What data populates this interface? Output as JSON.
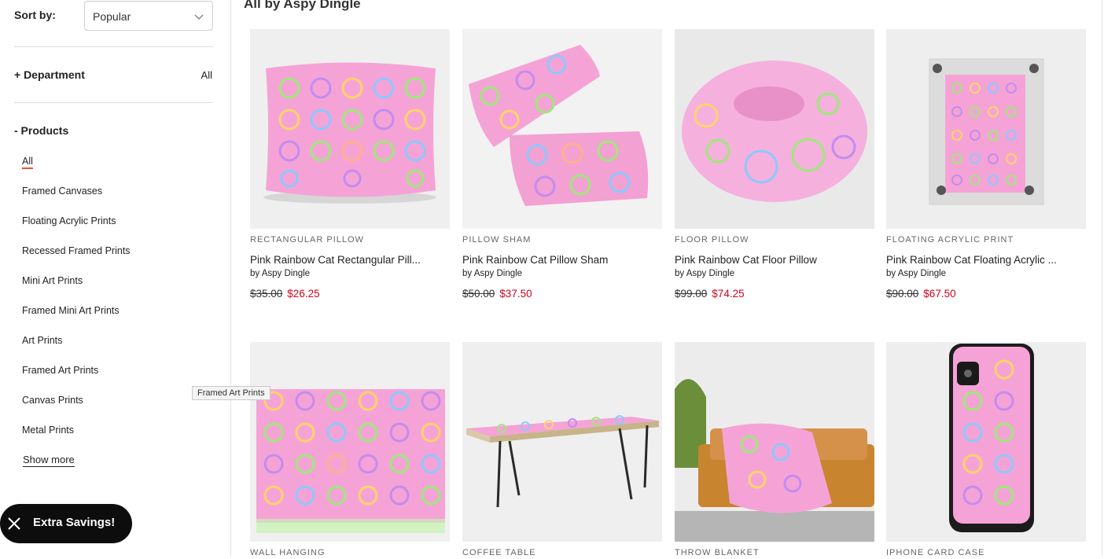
{
  "sidebar": {
    "sort_label": "Sort by:",
    "sort_value": "Popular",
    "department": {
      "label": "+ Department",
      "value": "All"
    },
    "products": {
      "label": "- Products",
      "items": [
        "All",
        "Framed Canvases",
        "Floating Acrylic Prints",
        "Recessed Framed Prints",
        "Mini Art Prints",
        "Framed Mini Art Prints",
        "Art Prints",
        "Framed Art Prints",
        "Canvas Prints",
        "Metal Prints"
      ],
      "active": "All"
    },
    "show_more": "Show more",
    "tooltip": "Framed Art Prints",
    "savings_label": "Extra Savings!"
  },
  "main": {
    "title": "All by Aspy Dingle",
    "products": [
      {
        "category": "RECTANGULAR PILLOW",
        "title": "Pink Rainbow Cat Rectangular Pill...",
        "by": "by Aspy Dingle",
        "old_price": "$35.00",
        "price": "$26.25"
      },
      {
        "category": "PILLOW SHAM",
        "title": "Pink Rainbow Cat Pillow Sham",
        "by": "by Aspy Dingle",
        "old_price": "$50.00",
        "price": "$37.50"
      },
      {
        "category": "FLOOR PILLOW",
        "title": "Pink Rainbow Cat Floor Pillow",
        "by": "by Aspy Dingle",
        "old_price": "$99.00",
        "price": "$74.25"
      },
      {
        "category": "FLOATING ACRYLIC PRINT",
        "title": "Pink Rainbow Cat Floating Acrylic ...",
        "by": "by Aspy Dingle",
        "old_price": "$90.00",
        "price": "$67.50"
      },
      {
        "category": "WALL HANGING"
      },
      {
        "category": "COFFEE TABLE"
      },
      {
        "category": "THROW BLANKET"
      },
      {
        "category": "IPHONE CARD CASE"
      }
    ]
  },
  "colors": {
    "sale_red": "#d0021b",
    "active_underline": "#e8542a",
    "product_pink": "#f5a3d6"
  }
}
